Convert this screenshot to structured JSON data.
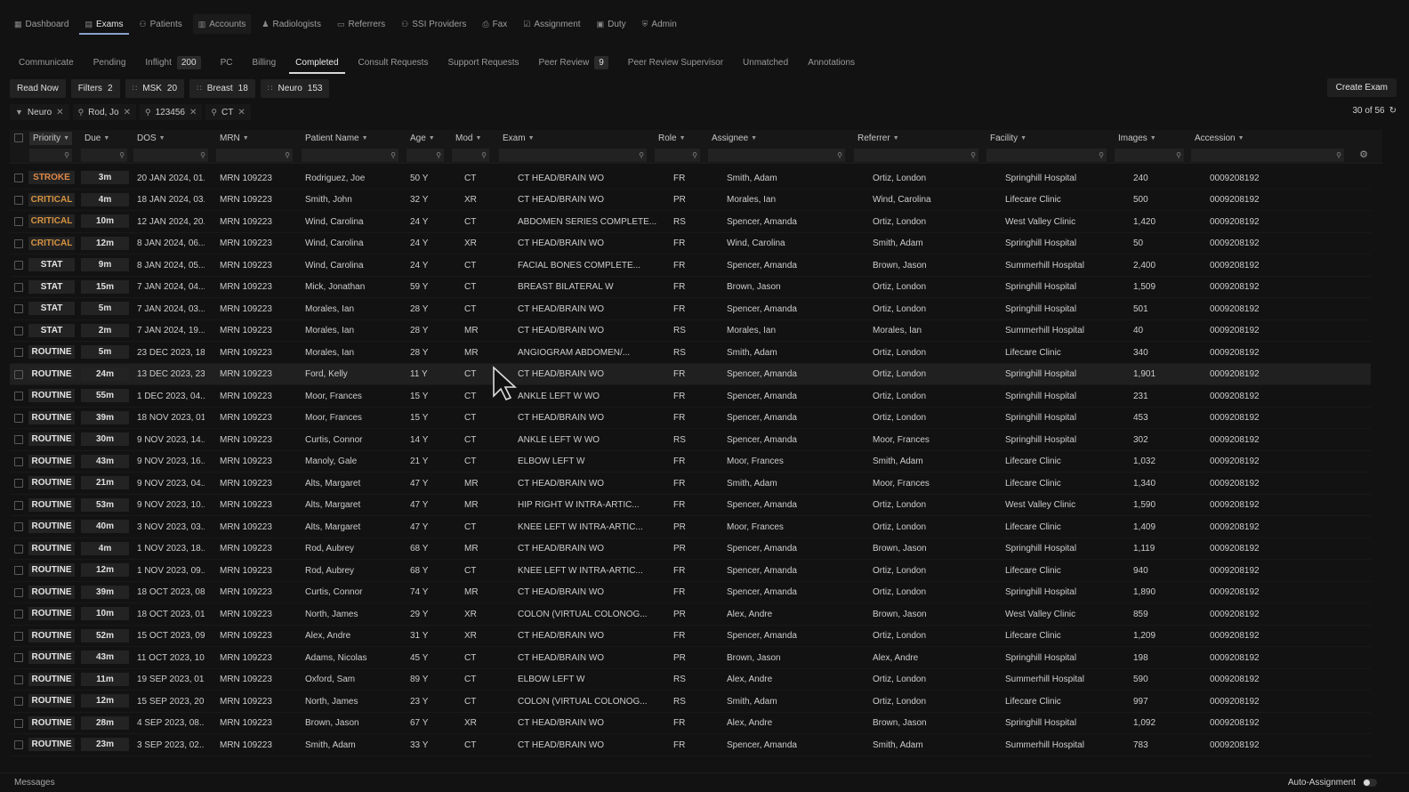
{
  "colors": {
    "stroke": "#e0894a",
    "critical": "#d79340",
    "routine": "#e6e6e6",
    "stat": "#e6e6e6"
  },
  "topnav": [
    {
      "label": "Dashboard",
      "icon": "grid-icon"
    },
    {
      "label": "Exams",
      "icon": "exams-icon",
      "active": true
    },
    {
      "label": "Patients",
      "icon": "users-icon"
    },
    {
      "label": "Accounts",
      "icon": "accounts-icon",
      "boxed": true
    },
    {
      "label": "Radiologists",
      "icon": "person-icon"
    },
    {
      "label": "Referrers",
      "icon": "card-icon"
    },
    {
      "label": "SSI Providers",
      "icon": "group-icon"
    },
    {
      "label": "Fax",
      "icon": "fax-icon"
    },
    {
      "label": "Assignment",
      "icon": "check-icon"
    },
    {
      "label": "Duty",
      "icon": "briefcase-icon"
    },
    {
      "label": "Admin",
      "icon": "shield-icon"
    }
  ],
  "subtabs": [
    {
      "label": "Communicate"
    },
    {
      "label": "Pending"
    },
    {
      "label": "Inflight",
      "count": "200"
    },
    {
      "label": "PC"
    },
    {
      "label": "Billing"
    },
    {
      "label": "Completed",
      "active": true
    },
    {
      "label": "Consult Requests"
    },
    {
      "label": "Support Requests"
    },
    {
      "label": "Peer Review",
      "count": "9"
    },
    {
      "label": "Peer Review Supervisor"
    },
    {
      "label": "Unmatched"
    },
    {
      "label": "Annotations"
    }
  ],
  "chips": [
    {
      "label": "Read Now"
    },
    {
      "label": "Filters",
      "count": "2"
    },
    {
      "label": "MSK",
      "count": "20",
      "dots": true
    },
    {
      "label": "Breast",
      "count": "18",
      "dots": true
    },
    {
      "label": "Neuro",
      "count": "153",
      "dots": true
    }
  ],
  "create_label": "Create Exam",
  "filters": [
    {
      "icon": "funnel-icon",
      "label": "Neuro"
    },
    {
      "icon": "search-icon",
      "label": "Rod, Jo"
    },
    {
      "icon": "search-icon",
      "label": "123456"
    },
    {
      "icon": "search-icon",
      "label": "CT"
    }
  ],
  "count_label": "30 of 56",
  "columns": [
    "Priority",
    "Due",
    "DOS",
    "MRN",
    "Patient Name",
    "Age",
    "Mod",
    "Exam",
    "Role",
    "Assignee",
    "Referrer",
    "Facility",
    "Images",
    "Accession"
  ],
  "rows": [
    [
      "STROKE",
      "3m",
      "20 JAN 2024, 01...",
      "MRN 109223",
      "Rodriguez, Joe",
      "50 Y",
      "CT",
      "CT HEAD/BRAIN WO",
      "FR",
      "Smith, Adam",
      "Ortiz, London",
      "Springhill Hospital",
      "240",
      "0009208192"
    ],
    [
      "CRITICAL",
      "4m",
      "18 JAN 2024, 03...",
      "MRN 109223",
      "Smith, John",
      "32 Y",
      "XR",
      "CT HEAD/BRAIN WO",
      "PR",
      "Morales, Ian",
      "Wind, Carolina",
      "Lifecare Clinic",
      "500",
      "0009208192"
    ],
    [
      "CRITICAL",
      "10m",
      "12 JAN 2024, 20...",
      "MRN 109223",
      "Wind, Carolina",
      "24 Y",
      "CT",
      "ABDOMEN SERIES COMPLETE...",
      "RS",
      "Spencer, Amanda",
      "Ortiz, London",
      "West Valley Clinic",
      "1,420",
      "0009208192"
    ],
    [
      "CRITICAL",
      "12m",
      "8 JAN 2024, 06...",
      "MRN 109223",
      "Wind, Carolina",
      "24 Y",
      "XR",
      "CT HEAD/BRAIN WO",
      "FR",
      "Wind, Carolina",
      "Smith, Adam",
      "Springhill Hospital",
      "50",
      "0009208192"
    ],
    [
      "STAT",
      "9m",
      "8 JAN 2024, 05...",
      "MRN 109223",
      "Wind, Carolina",
      "24 Y",
      "CT",
      "FACIAL BONES COMPLETE...",
      "FR",
      "Spencer, Amanda",
      "Brown, Jason",
      "Summerhill Hospital",
      "2,400",
      "0009208192"
    ],
    [
      "STAT",
      "15m",
      "7 JAN 2024, 04...",
      "MRN 109223",
      "Mick, Jonathan",
      "59 Y",
      "CT",
      "BREAST BILATERAL W",
      "FR",
      "Brown, Jason",
      "Ortiz, London",
      "Springhill Hospital",
      "1,509",
      "0009208192"
    ],
    [
      "STAT",
      "5m",
      "7 JAN 2024, 03...",
      "MRN 109223",
      "Morales, Ian",
      "28 Y",
      "CT",
      "CT HEAD/BRAIN WO",
      "FR",
      "Spencer, Amanda",
      "Ortiz, London",
      "Springhill Hospital",
      "501",
      "0009208192"
    ],
    [
      "STAT",
      "2m",
      "7 JAN 2024, 19...",
      "MRN 109223",
      "Morales, Ian",
      "28 Y",
      "MR",
      "CT HEAD/BRAIN WO",
      "RS",
      "Morales, Ian",
      "Morales, Ian",
      "Summerhill Hospital",
      "40",
      "0009208192"
    ],
    [
      "ROUTINE",
      "5m",
      "23 DEC 2023, 18...",
      "MRN 109223",
      "Morales, Ian",
      "28 Y",
      "MR",
      "ANGIOGRAM ABDOMEN/...",
      "RS",
      "Smith, Adam",
      "Ortiz, London",
      "Lifecare Clinic",
      "340",
      "0009208192"
    ],
    [
      "ROUTINE",
      "24m",
      "13 DEC 2023, 23...",
      "MRN 109223",
      "Ford, Kelly",
      "11 Y",
      "CT",
      "CT HEAD/BRAIN WO",
      "FR",
      "Spencer, Amanda",
      "Ortiz, London",
      "Springhill Hospital",
      "1,901",
      "0009208192"
    ],
    [
      "ROUTINE",
      "55m",
      "1 DEC 2023, 04...",
      "MRN 109223",
      "Moor, Frances",
      "15 Y",
      "CT",
      "ANKLE LEFT W WO",
      "FR",
      "Spencer, Amanda",
      "Ortiz, London",
      "Springhill Hospital",
      "231",
      "0009208192"
    ],
    [
      "ROUTINE",
      "39m",
      "18 NOV 2023, 01...",
      "MRN 109223",
      "Moor, Frances",
      "15 Y",
      "CT",
      "CT HEAD/BRAIN WO",
      "FR",
      "Spencer, Amanda",
      "Ortiz, London",
      "Springhill Hospital",
      "453",
      "0009208192"
    ],
    [
      "ROUTINE",
      "30m",
      "9 NOV 2023, 14...",
      "MRN 109223",
      "Curtis, Connor",
      "14 Y",
      "CT",
      "ANKLE LEFT W WO",
      "RS",
      "Spencer, Amanda",
      "Moor, Frances",
      "Springhill Hospital",
      "302",
      "0009208192"
    ],
    [
      "ROUTINE",
      "43m",
      "9 NOV 2023, 16...",
      "MRN 109223",
      "Manoly, Gale",
      "21 Y",
      "CT",
      "ELBOW LEFT W",
      "FR",
      "Moor, Frances",
      "Smith, Adam",
      "Lifecare Clinic",
      "1,032",
      "0009208192"
    ],
    [
      "ROUTINE",
      "21m",
      "9 NOV 2023, 04...",
      "MRN 109223",
      "Alts, Margaret",
      "47 Y",
      "MR",
      "CT HEAD/BRAIN WO",
      "FR",
      "Smith, Adam",
      "Moor, Frances",
      "Lifecare Clinic",
      "1,340",
      "0009208192"
    ],
    [
      "ROUTINE",
      "53m",
      "9 NOV 2023, 10...",
      "MRN 109223",
      "Alts, Margaret",
      "47 Y",
      "MR",
      "HIP RIGHT W INTRA-ARTIC...",
      "FR",
      "Spencer, Amanda",
      "Ortiz, London",
      "West Valley Clinic",
      "1,590",
      "0009208192"
    ],
    [
      "ROUTINE",
      "40m",
      "3 NOV 2023, 03...",
      "MRN 109223",
      "Alts, Margaret",
      "47 Y",
      "CT",
      "KNEE LEFT W INTRA-ARTIC...",
      "PR",
      "Moor, Frances",
      "Ortiz, London",
      "Lifecare Clinic",
      "1,409",
      "0009208192"
    ],
    [
      "ROUTINE",
      "4m",
      "1 NOV 2023, 18...",
      "MRN 109223",
      "Rod, Aubrey",
      "68 Y",
      "MR",
      "CT HEAD/BRAIN WO",
      "PR",
      "Spencer, Amanda",
      "Brown, Jason",
      "Springhill Hospital",
      "1,119",
      "0009208192"
    ],
    [
      "ROUTINE",
      "12m",
      "1 NOV 2023, 09...",
      "MRN 109223",
      "Rod, Aubrey",
      "68 Y",
      "CT",
      "KNEE LEFT W INTRA-ARTIC...",
      "FR",
      "Spencer, Amanda",
      "Ortiz, London",
      "Lifecare Clinic",
      "940",
      "0009208192"
    ],
    [
      "ROUTINE",
      "39m",
      "18 OCT 2023, 08...",
      "MRN 109223",
      "Curtis, Connor",
      "74 Y",
      "MR",
      "CT HEAD/BRAIN WO",
      "FR",
      "Spencer, Amanda",
      "Ortiz, London",
      "Springhill Hospital",
      "1,890",
      "0009208192"
    ],
    [
      "ROUTINE",
      "10m",
      "18 OCT 2023, 01...",
      "MRN 109223",
      "North, James",
      "29 Y",
      "XR",
      "COLON (VIRTUAL COLONOG...",
      "PR",
      "Alex, Andre",
      "Brown, Jason",
      "West Valley Clinic",
      "859",
      "0009208192"
    ],
    [
      "ROUTINE",
      "52m",
      "15 OCT 2023, 09...",
      "MRN 109223",
      "Alex, Andre",
      "31 Y",
      "XR",
      "CT HEAD/BRAIN WO",
      "FR",
      "Spencer, Amanda",
      "Ortiz, London",
      "Lifecare Clinic",
      "1,209",
      "0009208192"
    ],
    [
      "ROUTINE",
      "43m",
      "11 OCT 2023, 10...",
      "MRN 109223",
      "Adams, Nicolas",
      "45 Y",
      "CT",
      "CT HEAD/BRAIN WO",
      "PR",
      "Brown, Jason",
      "Alex, Andre",
      "Springhill Hospital",
      "198",
      "0009208192"
    ],
    [
      "ROUTINE",
      "11m",
      "19 SEP 2023, 01...",
      "MRN 109223",
      "Oxford, Sam",
      "89 Y",
      "CT",
      "ELBOW LEFT W",
      "RS",
      "Alex, Andre",
      "Ortiz, London",
      "Summerhill Hospital",
      "590",
      "0009208192"
    ],
    [
      "ROUTINE",
      "12m",
      "15 SEP 2023, 20...",
      "MRN 109223",
      "North, James",
      "23 Y",
      "CT",
      "COLON (VIRTUAL COLONOG...",
      "RS",
      "Smith, Adam",
      "Ortiz, London",
      "Lifecare Clinic",
      "997",
      "0009208192"
    ],
    [
      "ROUTINE",
      "28m",
      "4 SEP 2023, 08...",
      "MRN 109223",
      "Brown, Jason",
      "67 Y",
      "XR",
      "CT HEAD/BRAIN WO",
      "FR",
      "Alex, Andre",
      "Brown, Jason",
      "Springhill Hospital",
      "1,092",
      "0009208192"
    ],
    [
      "ROUTINE",
      "23m",
      "3 SEP 2023, 02...",
      "MRN 109223",
      "Smith, Adam",
      "33 Y",
      "CT",
      "CT HEAD/BRAIN WO",
      "FR",
      "Spencer, Amanda",
      "Smith, Adam",
      "Summerhill Hospital",
      "783",
      "0009208192"
    ]
  ],
  "highlight_row": 9,
  "footer": {
    "messages": "Messages",
    "auto_assignment": "Auto-Assignment"
  }
}
